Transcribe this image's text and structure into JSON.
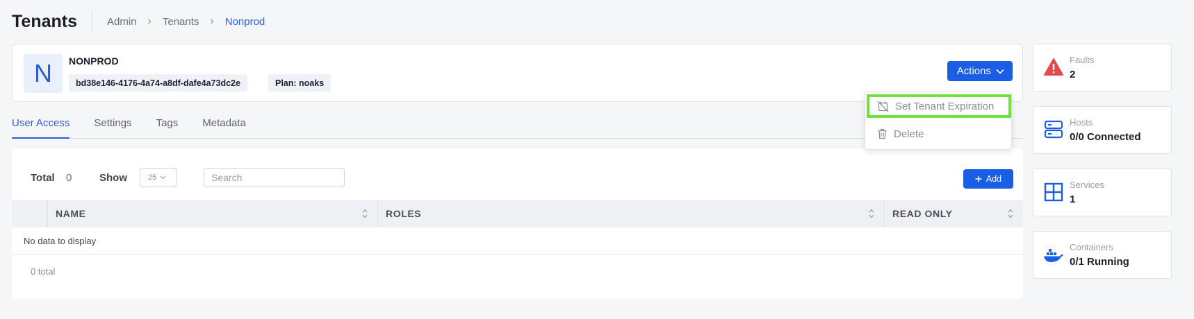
{
  "header": {
    "title": "Tenants",
    "breadcrumb": [
      "Admin",
      "Tenants",
      "Nonprod"
    ]
  },
  "tenant": {
    "avatar_letter": "N",
    "name": "NONPROD",
    "id": "bd38e146-4176-4a74-a8df-dafe4a73dc2e",
    "plan": "Plan: noaks",
    "actions_label": "Actions"
  },
  "actions_menu": {
    "items": [
      {
        "label": "Set Tenant Expiration",
        "icon": "calendar-off-icon"
      },
      {
        "label": "Delete",
        "icon": "trash-icon"
      }
    ]
  },
  "tabs": [
    {
      "label": "User Access",
      "active": true
    },
    {
      "label": "Settings",
      "active": false
    },
    {
      "label": "Tags",
      "active": false
    },
    {
      "label": "Metadata",
      "active": false
    }
  ],
  "table": {
    "total_label": "Total",
    "total_value": "0",
    "show_label": "Show",
    "show_value": "25",
    "search_placeholder": "Search",
    "add_label": "Add",
    "columns": [
      "NAME",
      "ROLES",
      "READ ONLY"
    ],
    "empty_message": "No data to display",
    "footer_total": "0 total"
  },
  "stats": [
    {
      "label": "Faults",
      "value": "2",
      "icon": "warning-icon",
      "color": "#e5484d"
    },
    {
      "label": "Hosts",
      "value": "0/0 Connected",
      "icon": "server-icon",
      "color": "#1a5ee6"
    },
    {
      "label": "Services",
      "value": "1",
      "icon": "grid-icon",
      "color": "#1a5ee6"
    },
    {
      "label": "Containers",
      "value": "0/1 Running",
      "icon": "docker-icon",
      "color": "#1a5ee6"
    }
  ],
  "colors": {
    "primary": "#1a5ee6",
    "highlight": "#6fe23f",
    "danger": "#e5484d"
  }
}
